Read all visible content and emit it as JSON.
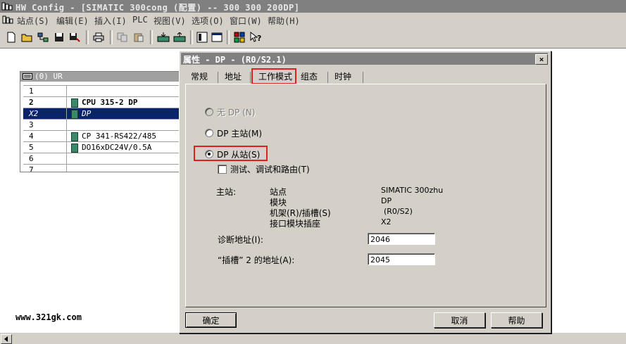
{
  "app": {
    "title": "HW Config - [SIMATIC 300cong (配置) -- 300 300 200DP]"
  },
  "menu": {
    "items": [
      "站点(S)",
      "编辑(E)",
      "插入(I)",
      "PLC",
      "视图(V)",
      "选项(O)",
      "窗口(W)",
      "帮助(H)"
    ]
  },
  "rack": {
    "title": "(0) UR",
    "rows": [
      {
        "slot": "1",
        "module": ""
      },
      {
        "slot": "2",
        "module": "CPU 315-2 DP"
      },
      {
        "slot": "X2",
        "module": "DP"
      },
      {
        "slot": "3",
        "module": ""
      },
      {
        "slot": "4",
        "module": "CP 341-RS422/485"
      },
      {
        "slot": "5",
        "module": "DO16xDC24V/0.5A"
      },
      {
        "slot": "6",
        "module": ""
      },
      {
        "slot": "7",
        "module": ""
      }
    ]
  },
  "watermark": "www.321gk.com",
  "dialog": {
    "title": "属性 - DP - (R0/S2.1)",
    "close_label": "×",
    "tabs": [
      "常规",
      "地址",
      "工作模式",
      "组态",
      "时钟"
    ],
    "active_tab": "工作模式",
    "modes": {
      "no_dp": "无 DP (N)",
      "master": "DP 主站(M)",
      "slave": "DP 从站(S)"
    },
    "test_checkbox": "测试、调试和路由(T)",
    "master_info": {
      "label": "主站:",
      "station_label": "站点",
      "station_value": "SIMATIC 300zhu",
      "module_label": "模块",
      "module_value": "DP",
      "rack_label": "机架(R)/插槽(S)",
      "rack_value": "(R0/S2)",
      "interface_label": "接口模块插座",
      "interface_value": "X2"
    },
    "diag": {
      "label": "诊断地址(I):",
      "value": "2046"
    },
    "slot2": {
      "label": "“插槽” 2 的地址(A):",
      "value": "2045"
    },
    "ok_label": "确定",
    "cancel_label": "取消",
    "help_label": "帮助"
  },
  "colors": {
    "highlight": "#e02020",
    "selection": "#0a246a",
    "face": "#d4d0c8"
  }
}
